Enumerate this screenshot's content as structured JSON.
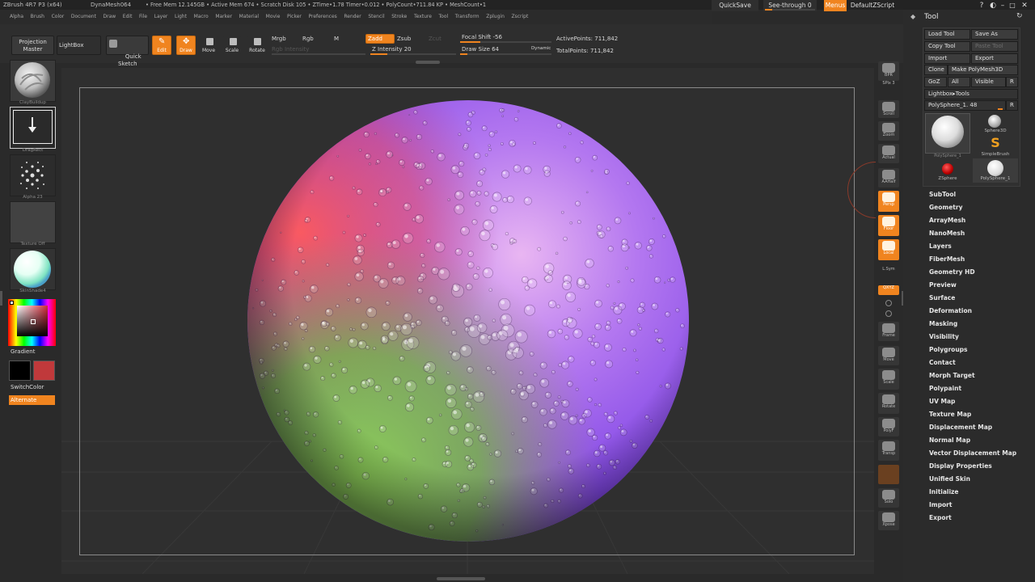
{
  "titlebar": {
    "app": "ZBrush 4R7 P3 (x64)",
    "document": "DynaMesh064",
    "free_mem": "• Free Mem 12.145GB • Active Mem 674 • Scratch Disk 105 • ZTime•1.78 Timer•0.012 • PolyCount•711.84 KP • MeshCount•1",
    "quicksave": "QuickSave",
    "see_through": "See-through  0",
    "menus": "Menus",
    "default_script": "DefaultZScript"
  },
  "menubar": [
    "Alpha",
    "Brush",
    "Color",
    "Document",
    "Draw",
    "Edit",
    "File",
    "Layer",
    "Light",
    "Macro",
    "Marker",
    "Material",
    "Movie",
    "Picker",
    "Preferences",
    "Render",
    "Stencil",
    "Stroke",
    "Texture",
    "Tool",
    "Transform",
    "Zplugin",
    "Zscript"
  ],
  "toolbar": {
    "projection_master": "Projection\nMaster",
    "lightbox": "LightBox",
    "quick_sketch": "Quick\nSketch",
    "edit": "Edit",
    "draw": "Draw",
    "move": "Move",
    "scale": "Scale",
    "rotate": "Rotate",
    "mrgb": "Mrgb",
    "rgb": "Rgb",
    "m": "M",
    "rgb_intensity": "Rgb Intensity",
    "zadd": "Zadd",
    "zsub": "Zsub",
    "zcut": "Zcut",
    "z_intensity": "Z Intensity 20",
    "focal_shift": "Focal Shift -56",
    "draw_size": "Draw Size 64",
    "dynamic": "Dynamic",
    "active_points": "ActivePoints: 711,842",
    "total_points": "TotalPoints: 711,842",
    "z_intensity_value": 20,
    "focal_shift_value": -56,
    "draw_size_value": 64
  },
  "left_shelf": {
    "brush": "ClayBuildup",
    "stroke": "DragRect",
    "alpha": "Alpha 23",
    "texture": "Texture Off",
    "material": "SkinShade4",
    "gradient": "Gradient",
    "switch_color": "SwitchColor",
    "alternate": "Alternate",
    "main_color": "#000000",
    "secondary_color": "#c0393b"
  },
  "right_shelf": [
    {
      "name": "bpr",
      "label": "BPR"
    },
    {
      "name": "spix",
      "label": "SPix 3"
    },
    {
      "name": "scroll",
      "label": "Scroll"
    },
    {
      "name": "zoom",
      "label": "Zoom"
    },
    {
      "name": "actual",
      "label": "Actual"
    },
    {
      "name": "aahalf",
      "label": "AAHalf"
    },
    {
      "name": "persp",
      "label": "Persp"
    },
    {
      "name": "floor",
      "label": "Floor"
    },
    {
      "name": "local",
      "label": "Local"
    },
    {
      "name": "lsym",
      "label": "L.Sym"
    },
    {
      "name": "xyz",
      "label": "QXYZ"
    },
    {
      "name": "frame",
      "label": "Frame"
    },
    {
      "name": "move",
      "label": "Move"
    },
    {
      "name": "scale",
      "label": "Scale"
    },
    {
      "name": "rotate",
      "label": "Rotate"
    },
    {
      "name": "polyf",
      "label": "PolyF"
    },
    {
      "name": "transp",
      "label": "Transp"
    },
    {
      "name": "solo",
      "label": "Solo"
    },
    {
      "name": "xpose",
      "label": "Xpose"
    }
  ],
  "tool_panel": {
    "title": "Tool",
    "load_tool": "Load Tool",
    "save_as": "Save As",
    "copy_tool": "Copy Tool",
    "paste_tool": "Paste Tool",
    "import": "Import",
    "export": "Export",
    "clone": "Clone",
    "make_polymesh": "Make PolyMesh3D",
    "goz": "GoZ",
    "all": "All",
    "visible": "Visible",
    "r": "R",
    "lightbox_tools": "Lightbox▸Tools",
    "current_tool": "PolySphere_1. 48",
    "thumbs": [
      "PolySphere_1",
      "Sphere3D",
      "SimpleBrush",
      "ZSphere",
      "PolySphere_1"
    ],
    "sections": [
      "SubTool",
      "Geometry",
      "ArrayMesh",
      "NanoMesh",
      "Layers",
      "FiberMesh",
      "Geometry HD",
      "Preview",
      "Surface",
      "Deformation",
      "Masking",
      "Visibility",
      "Polygroups",
      "Contact",
      "Morph Target",
      "Polypaint",
      "UV Map",
      "Texture Map",
      "Displacement Map",
      "Normal Map",
      "Vector Displacement Map",
      "Display Properties",
      "Unified Skin",
      "Initialize",
      "Import",
      "Export"
    ]
  }
}
